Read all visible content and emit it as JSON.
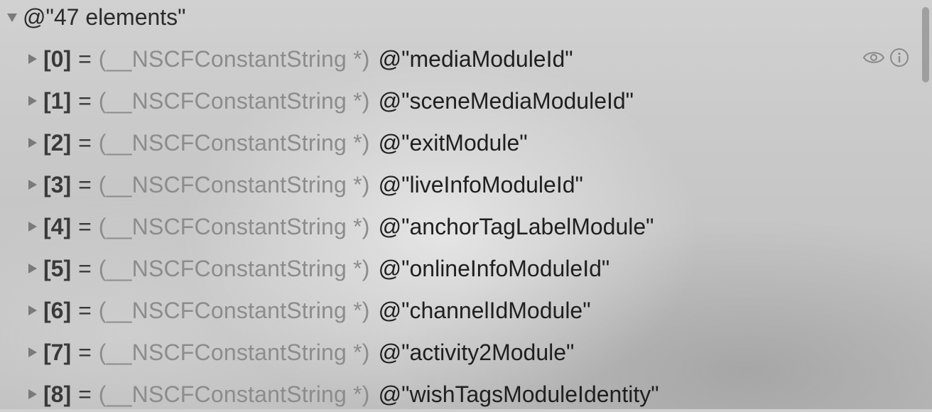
{
  "root": {
    "label": "@\"47 elements\""
  },
  "type_label": "(__NSCFConstantString *)",
  "equals": "=",
  "rows": [
    {
      "index": "[0]",
      "value": "@\"mediaModuleId\""
    },
    {
      "index": "[1]",
      "value": "@\"sceneMediaModuleId\""
    },
    {
      "index": "[2]",
      "value": "@\"exitModule\""
    },
    {
      "index": "[3]",
      "value": "@\"liveInfoModuleId\""
    },
    {
      "index": "[4]",
      "value": "@\"anchorTagLabelModule\""
    },
    {
      "index": "[5]",
      "value": "@\"onlineInfoModuleId\""
    },
    {
      "index": "[6]",
      "value": "@\"channelIdModule\""
    },
    {
      "index": "[7]",
      "value": "@\"activity2Module\""
    },
    {
      "index": "[8]",
      "value": "@\"wishTagsModuleIdentity\""
    }
  ],
  "icons": {
    "disclosure_expanded": "disclosure-triangle-down-icon",
    "disclosure_collapsed": "disclosure-triangle-right-icon",
    "quick_look": "eye-icon",
    "info": "info-icon"
  },
  "colors": {
    "index_text": "#3a3a3a",
    "type_text": "#8c8c8c",
    "value_text": "#1f1f1f",
    "disclosure": "#7a7a7a"
  }
}
